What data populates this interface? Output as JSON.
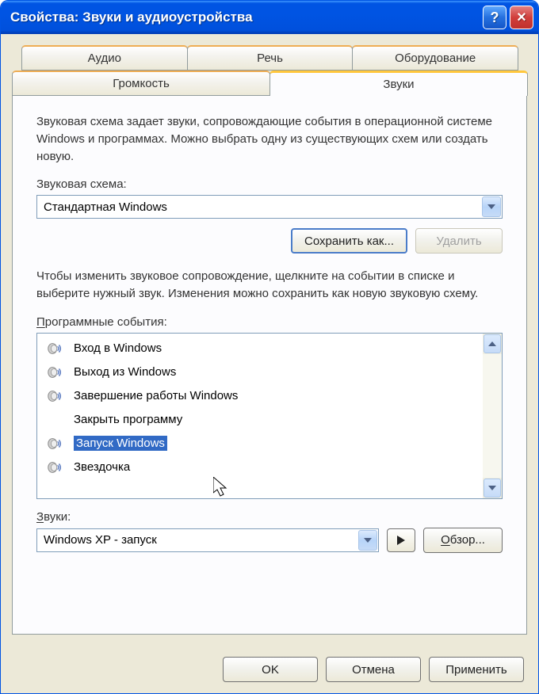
{
  "window": {
    "title": "Свойства: Звуки и аудиоустройства"
  },
  "tabs": {
    "back": [
      {
        "label": "Аудио"
      },
      {
        "label": "Речь"
      },
      {
        "label": "Оборудование"
      }
    ],
    "front": [
      {
        "label": "Громкость"
      },
      {
        "label": "Звуки"
      }
    ],
    "active": "Звуки"
  },
  "panel": {
    "scheme_desc": "Звуковая схема задает звуки, сопровождающие события в операционной системе Windows и программах. Можно выбрать одну из существующих схем или создать новую.",
    "scheme_label": "Звуковая схема:",
    "scheme_value": "Стандартная Windows",
    "save_as_label": "Сохранить как...",
    "delete_label": "Удалить",
    "events_desc": "Чтобы изменить звуковое сопровождение, щелкните на событии в списке и выберите нужный звук. Изменения можно сохранить как новую звуковую схему.",
    "events_label": "Программные события:",
    "events": [
      {
        "label": "Вход в Windows",
        "has_sound": true,
        "selected": false
      },
      {
        "label": "Выход из Windows",
        "has_sound": true,
        "selected": false
      },
      {
        "label": "Завершение работы Windows",
        "has_sound": true,
        "selected": false
      },
      {
        "label": "Закрыть программу",
        "has_sound": false,
        "selected": false
      },
      {
        "label": "Запуск Windows",
        "has_sound": true,
        "selected": true
      },
      {
        "label": "Звездочка",
        "has_sound": true,
        "selected": false
      }
    ],
    "sounds_label": "Звуки:",
    "sounds_value": "Windows XP - запуск",
    "browse_label": "Обзор..."
  },
  "buttons": {
    "ok": "OK",
    "cancel": "Отмена",
    "apply": "Применить"
  }
}
